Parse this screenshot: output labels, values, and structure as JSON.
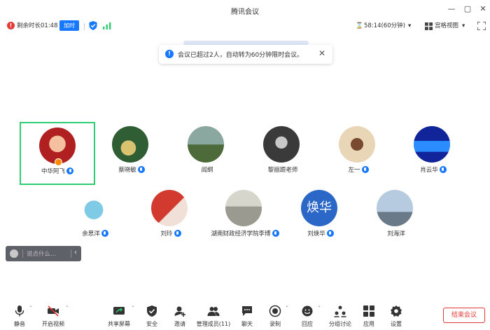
{
  "window": {
    "title": "腾讯会议"
  },
  "info_bar": {
    "remaining": "剩余时长01:48",
    "extend_label": "加时",
    "timer": "58:14(60分钟)",
    "view_label": "宫格视图"
  },
  "notice": {
    "message": "会议已超过2人，自动转为60分钟限时会议。"
  },
  "participants": [
    {
      "name": "中华阿飞",
      "avatar_colors": [
        "#b02020",
        "#f4c0a0"
      ]
    },
    {
      "name": "蔡晓敏",
      "avatar_colors": [
        "#2f5d34",
        "#d9c270"
      ]
    },
    {
      "name": "阎纲",
      "avatar_colors": [
        "#8aa8a0",
        "#4d6b3a"
      ]
    },
    {
      "name": "黎丽跟老师",
      "avatar_colors": [
        "#3a3a3a",
        "#c8c8c8"
      ]
    },
    {
      "name": "左一",
      "avatar_colors": [
        "#e8d6b6",
        "#7a4a30"
      ]
    },
    {
      "name": "肖云华",
      "avatar_colors": [
        "#12249a",
        "#2a8cff"
      ]
    },
    {
      "name": "余思洋",
      "avatar_colors": [
        "#ffffff",
        "#7fcbe6"
      ]
    },
    {
      "name": "刘玲",
      "avatar_colors": [
        "#d23a30",
        "#f0e0d8"
      ]
    },
    {
      "name": "湖南财政经济学院李博",
      "avatar_colors": [
        "#9a9a90",
        "#d6d6cc"
      ]
    },
    {
      "name": "刘焕华",
      "avatar_text": "焕华",
      "avatar_colors": [
        "#2b67c6",
        "#2b67c6"
      ]
    },
    {
      "name": "刘海洋",
      "avatar_colors": [
        "#b6cbe0",
        "#6a7a88"
      ]
    }
  ],
  "chat": {
    "placeholder": "说点什么..."
  },
  "toolbar": {
    "items": [
      {
        "label": "静音",
        "icon": "mic-icon"
      },
      {
        "label": "开启视频",
        "icon": "video-off-icon"
      },
      {
        "label": "共享屏幕",
        "icon": "share-screen-icon"
      },
      {
        "label": "安全",
        "icon": "shield-icon"
      },
      {
        "label": "邀请",
        "icon": "invite-icon"
      },
      {
        "label": "管理成员(11)",
        "icon": "members-icon"
      },
      {
        "label": "聊天",
        "icon": "chat-icon"
      },
      {
        "label": "录制",
        "icon": "record-icon"
      },
      {
        "label": "回应",
        "icon": "reaction-icon"
      },
      {
        "label": "分组讨论",
        "icon": "breakout-icon"
      },
      {
        "label": "应用",
        "icon": "apps-icon"
      },
      {
        "label": "设置",
        "icon": "settings-icon"
      }
    ],
    "end_label": "结束会议"
  },
  "colors": {
    "accent": "#1677ff",
    "danger": "#e53935",
    "active_border": "#2ecc71"
  }
}
